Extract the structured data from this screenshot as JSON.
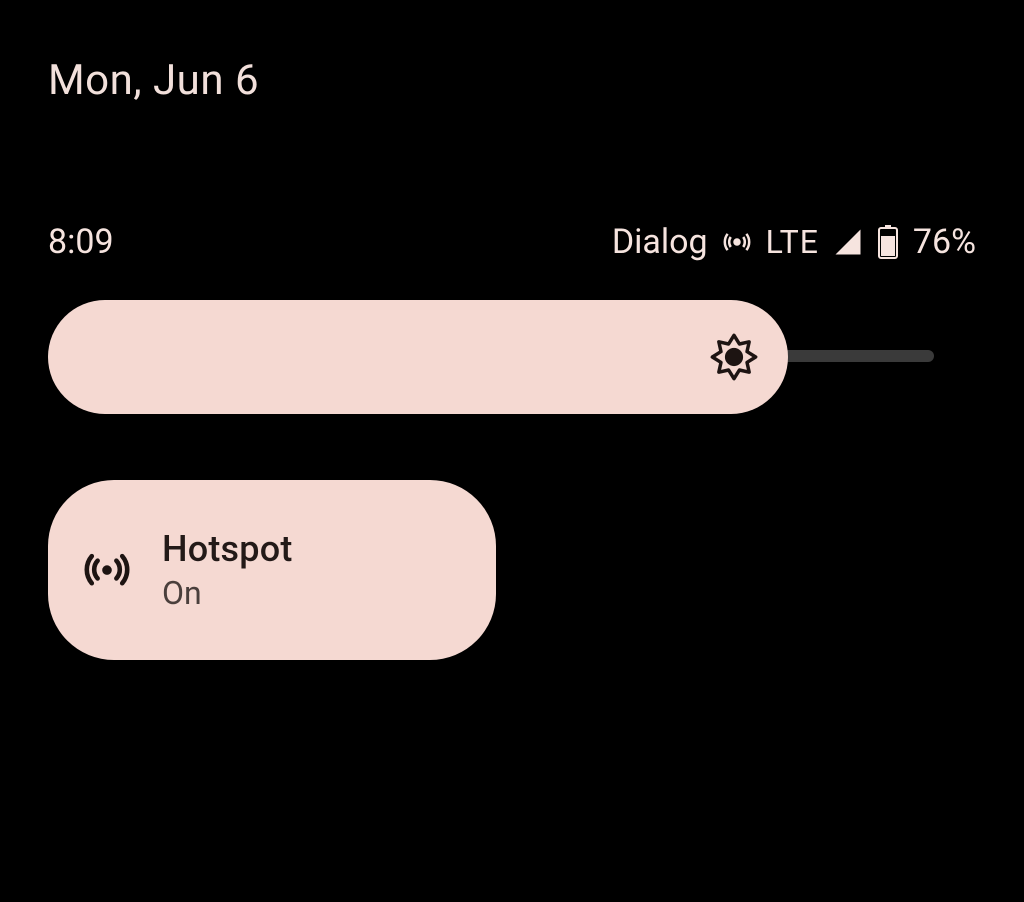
{
  "date": "Mon, Jun 6",
  "statusbar": {
    "clock": "8:09",
    "carrier": "Dialog",
    "network": "LTE",
    "battery_pct": "76%"
  },
  "brightness": {
    "value_pct": 83
  },
  "tile": {
    "title": "Hotspot",
    "subtitle": "On"
  },
  "colors": {
    "accent": "#f5d9d2",
    "text": "#f2e0db",
    "track": "#3a3a3a"
  }
}
